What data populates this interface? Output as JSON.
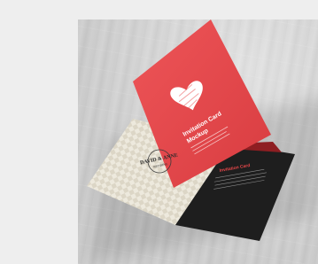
{
  "card": {
    "title_line1": "Invitation Card",
    "title_line2": "Mockup",
    "back_title": "Invitation Card",
    "logo_top": "DAVID & ANNE",
    "logo_bottom": "WEDDING"
  },
  "colors": {
    "background": "#eeeeee",
    "card_red": "#e8474a",
    "card_dark": "#1e1e1e",
    "card_cream": "#ece8dc"
  }
}
